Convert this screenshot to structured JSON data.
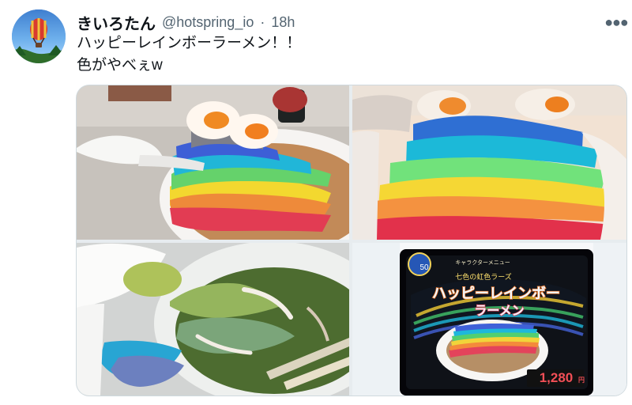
{
  "tweet": {
    "author": {
      "display_name": "きいろたん",
      "username": "@hotspring_io",
      "avatar_icon": "balloon-avatar-icon"
    },
    "separator": "·",
    "timestamp": "18h",
    "more_icon": "more-horizontal-icon",
    "text_lines": [
      "ハッピーレインボーラーメン！！",
      "色がやべぇw"
    ],
    "media": [
      {
        "kind": "photo",
        "subject": "rainbow ramen bowl with eggs"
      },
      {
        "kind": "photo",
        "subject": "close-up rainbow layered topping"
      },
      {
        "kind": "photo",
        "subject": "mixed green soup with spoon and chopsticks"
      },
      {
        "kind": "photo",
        "subject": "menu board poster"
      }
    ],
    "menu_poster": {
      "badge": "50",
      "title_small": "キャラクターメニュー",
      "title_mid": "七色の虹色ラーズ",
      "title_main_1": "ハッピーレインボー",
      "title_main_2": "ラーメン",
      "price": "1,280",
      "price_unit": "円"
    }
  },
  "colors": {
    "text_primary": "#0f1419",
    "text_secondary": "#536471",
    "border": "#cfd9de",
    "rainbow": [
      "#e23a46",
      "#f97b3d",
      "#f1d23a",
      "#63d16c",
      "#22b9d8",
      "#3f62d8",
      "#6d4fb2"
    ]
  }
}
